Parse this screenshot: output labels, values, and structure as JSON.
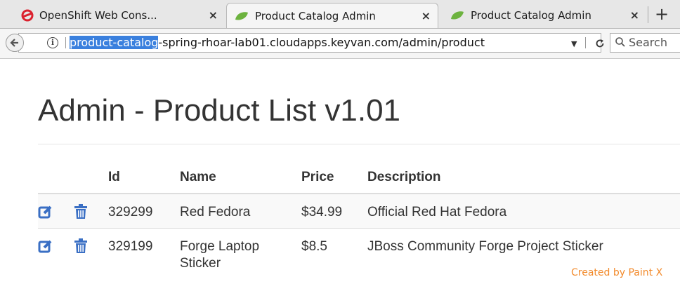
{
  "browser": {
    "tabs": [
      {
        "title": "OpenShift Web Cons...",
        "icon": "openshift-icon",
        "active": false
      },
      {
        "title": "Product Catalog Admin",
        "icon": "spring-leaf-icon",
        "active": true
      },
      {
        "title": "Product Catalog Admin",
        "icon": "spring-leaf-icon",
        "active": false
      }
    ],
    "close_glyph": "×",
    "newtab_glyph": "+",
    "url_selected": "product-catalog",
    "url_rest": "-spring-rhoar-lab01.cloudapps.keyvan.com/admin/product",
    "search_placeholder": "Search"
  },
  "page": {
    "title": "Admin - Product List v1.01",
    "columns": [
      "Id",
      "Name",
      "Price",
      "Description"
    ],
    "rows": [
      {
        "id": "329299",
        "name": "Red Fedora",
        "price": "$34.99",
        "description": "Official Red Hat Fedora"
      },
      {
        "id": "329199",
        "name": "Forge Laptop Sticker",
        "price": "$8.5",
        "description": "JBoss Community Forge Project Sticker"
      }
    ]
  },
  "watermark": "Created by Paint X",
  "colors": {
    "accent": "#3a6fc4",
    "selection": "#3a80de",
    "watermark": "#f28a2b"
  }
}
